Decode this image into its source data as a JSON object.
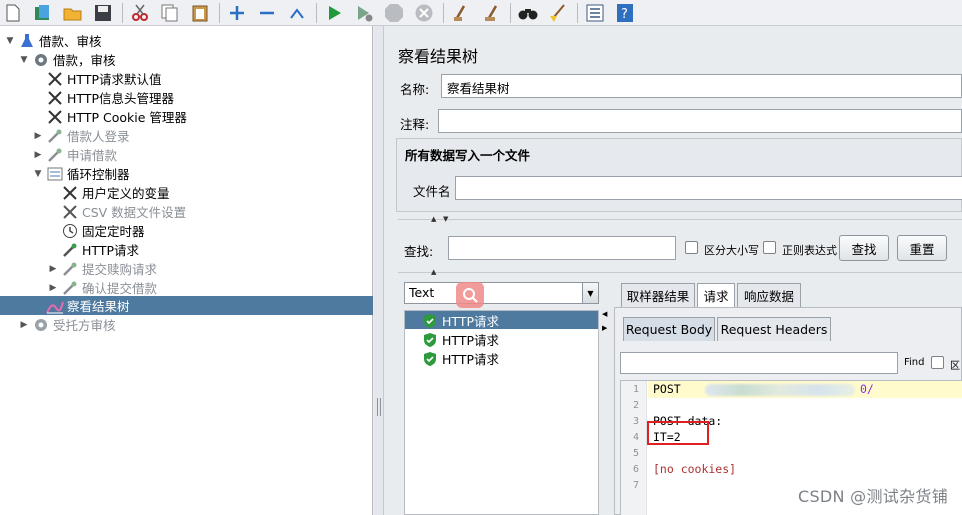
{
  "toolbar": {
    "icons": [
      "new-icon",
      "templates-icon",
      "open-icon",
      "save-icon",
      "cut-icon",
      "copy-icon",
      "paste-icon",
      "expand-icon",
      "collapse-icon",
      "toggle-icon",
      "start-icon",
      "start-no-pause-icon",
      "stop-icon",
      "shutdown-icon",
      "clear-icon",
      "clear-all-icon",
      "search-icon",
      "reset-search-icon",
      "function-helper-icon",
      "help-icon"
    ]
  },
  "tree": {
    "root": "借款、审核",
    "group": "借款，审核",
    "items": [
      {
        "label": "HTTP请求默认值",
        "icon": "wrench-icon",
        "enabled": true
      },
      {
        "label": "HTTP信息头管理器",
        "icon": "wrench-icon",
        "enabled": true
      },
      {
        "label": "HTTP Cookie 管理器",
        "icon": "wrench-icon",
        "enabled": true
      },
      {
        "label": "借款人登录",
        "icon": "pipette-icon",
        "enabled": false
      },
      {
        "label": "申请借款",
        "icon": "pipette-icon",
        "enabled": false
      },
      {
        "label": "循环控制器",
        "icon": "loop-icon",
        "enabled": true
      },
      {
        "label": "用户定义的变量",
        "icon": "wrench-icon",
        "enabled": true
      },
      {
        "label": "CSV 数据文件设置",
        "icon": "wrench-icon",
        "enabled": false
      },
      {
        "label": "固定定时器",
        "icon": "timer-icon",
        "enabled": true
      },
      {
        "label": "HTTP请求",
        "icon": "pipette-icon",
        "enabled": true
      },
      {
        "label": "提交赎购请求",
        "icon": "pipette-icon",
        "enabled": false
      },
      {
        "label": "确认提交借款",
        "icon": "pipette-icon",
        "enabled": false
      },
      {
        "label": "察看结果树",
        "icon": "chart-icon",
        "enabled": true
      },
      {
        "label": "受托方审核",
        "icon": "gear-icon",
        "enabled": false
      }
    ]
  },
  "panel": {
    "title": "察看结果树",
    "name_label": "名称:",
    "name_value": "察看结果树",
    "comment_label": "注释:",
    "comment_value": "",
    "file_section_title": "所有数据写入一个文件",
    "filename_label": "文件名",
    "filename_value": "",
    "search_label": "查找:",
    "search_value": "",
    "case_sensitive_label": "区分大小写",
    "regex_label": "正则表达式",
    "find_button": "查找",
    "reset_button": "重置"
  },
  "results": {
    "renderer": "Text",
    "samples": [
      "HTTP请求",
      "HTTP请求",
      "HTTP请求"
    ],
    "tabs": [
      "取样器结果",
      "请求",
      "响应数据"
    ],
    "active_tab": "请求",
    "subtabs": [
      "Request Body",
      "Request Headers"
    ],
    "active_subtab": "Request Body",
    "find_label": "Find",
    "find_checkbox_label": "区",
    "code_lines": [
      "POST",
      "",
      "POST data:",
      "IT=2",
      "",
      "[no cookies]",
      ""
    ],
    "url_tail": "0/",
    "line_numbers": [
      "1",
      "2",
      "3",
      "4",
      "5",
      "6",
      "7"
    ]
  },
  "watermark": "CSDN @测试杂货铺",
  "colors": {
    "selection": "#4f7a9f",
    "annotation_red": "#e02020",
    "keyword_purple": "#8a2be2"
  }
}
